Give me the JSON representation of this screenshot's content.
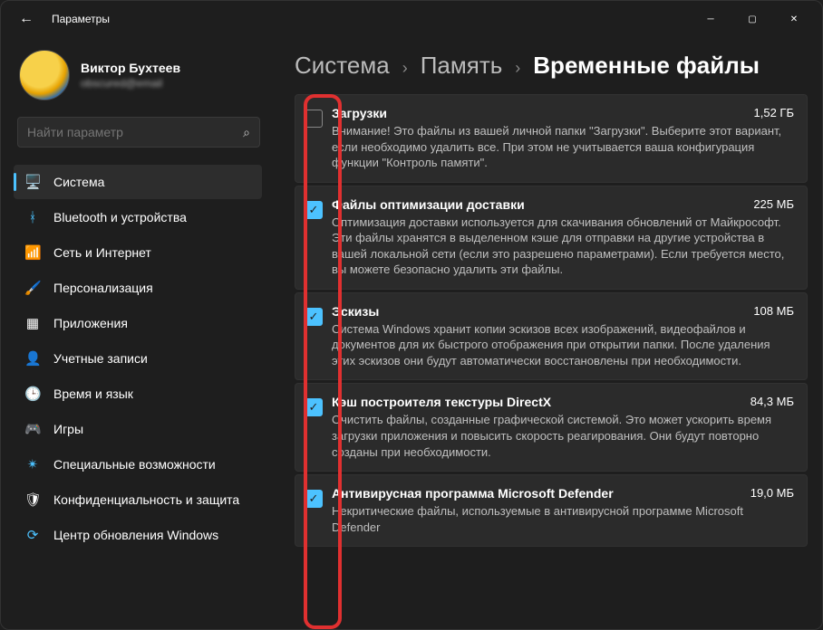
{
  "window": {
    "app_title": "Параметры"
  },
  "user": {
    "name": "Виктор Бухтеев",
    "email": "obscured@email"
  },
  "search": {
    "placeholder": "Найти параметр"
  },
  "nav": [
    {
      "label": "Система",
      "icon": "🖥️",
      "active": true,
      "key": "system"
    },
    {
      "label": "Bluetooth и устройства",
      "icon": "ᚼ",
      "icon_color": "#4cc2ff",
      "key": "bluetooth"
    },
    {
      "label": "Сеть и Интернет",
      "icon": "📶",
      "icon_color": "#4cc2ff",
      "key": "network"
    },
    {
      "label": "Персонализация",
      "icon": "🖌️",
      "key": "personalization"
    },
    {
      "label": "Приложения",
      "icon": "▦",
      "key": "apps"
    },
    {
      "label": "Учетные записи",
      "icon": "👤",
      "key": "accounts"
    },
    {
      "label": "Время и язык",
      "icon": "🕒",
      "key": "time"
    },
    {
      "label": "Игры",
      "icon": "🎮",
      "key": "gaming"
    },
    {
      "label": "Специальные возможности",
      "icon": "✴",
      "icon_color": "#4cc2ff",
      "key": "accessibility"
    },
    {
      "label": "Конфиденциальность и защита",
      "icon": "🛡",
      "key": "privacy"
    },
    {
      "label": "Центр обновления Windows",
      "icon": "⟳",
      "icon_color": "#4cc2ff",
      "key": "update"
    }
  ],
  "breadcrumb": {
    "a": "Система",
    "b": "Память",
    "current": "Временные файлы"
  },
  "items": [
    {
      "title": "Загрузки",
      "size": "1,52 ГБ",
      "checked": false,
      "desc": "Внимание! Это файлы из вашей личной папки \"Загрузки\". Выберите этот вариант, если необходимо удалить все. При этом не учитывается ваша конфигурация функции \"Контроль памяти\"."
    },
    {
      "title": "Файлы оптимизации доставки",
      "size": "225 МБ",
      "checked": true,
      "desc": "Оптимизация доставки используется для скачивания обновлений от Майкрософт. Эти файлы хранятся в выделенном кэше для отправки на другие устройства в вашей локальной сети (если это разрешено параметрами). Если требуется место, вы можете безопасно удалить эти файлы."
    },
    {
      "title": "Эскизы",
      "size": "108 МБ",
      "checked": true,
      "desc": "Система Windows хранит копии эскизов всех изображений, видеофайлов и документов для их быстрого отображения при открытии папки. После удаления этих эскизов они будут автоматически восстановлены при необходимости."
    },
    {
      "title": "Кэш построителя текстуры DirectX",
      "size": "84,3 МБ",
      "checked": true,
      "desc": "Очистить файлы, созданные графической системой. Это может ускорить время загрузки приложения и повысить скорость реагирования. Они будут повторно созданы при необходимости."
    },
    {
      "title": "Антивирусная программа Microsoft Defender",
      "size": "19,0 МБ",
      "checked": true,
      "desc": "Некритические файлы, используемые в антивирусной программе Microsoft Defender"
    }
  ]
}
